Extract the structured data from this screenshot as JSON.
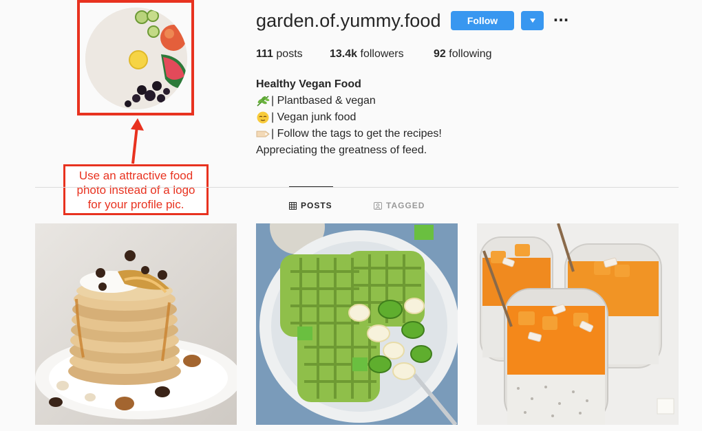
{
  "profile": {
    "username": "garden.of.yummy.food",
    "follow_label": "Follow",
    "more_label": "···"
  },
  "stats": [
    {
      "count": "111",
      "label": "posts"
    },
    {
      "count": "13.4k",
      "label": "followers"
    },
    {
      "count": "92",
      "label": "following"
    }
  ],
  "bio": {
    "name": "Healthy Vegan Food",
    "lines": [
      {
        "icon": "herb-icon",
        "text": "| Plantbased & vegan"
      },
      {
        "icon": "relieved-face-icon",
        "text": "| Vegan junk food"
      },
      {
        "icon": "label-tag-icon",
        "text": "| Follow the tags to get the recipes!"
      }
    ],
    "closing": "Appreciating the greatness of feed."
  },
  "tabs": [
    {
      "label": "POSTS",
      "icon": "grid-icon",
      "active": true
    },
    {
      "label": "TAGGED",
      "icon": "tagged-icon",
      "active": false
    }
  ],
  "annotation": {
    "lines": [
      "Use an attractive food",
      "photo instead of a logo",
      "for your profile pic."
    ],
    "color": "#e8321f"
  },
  "posts": [
    {
      "name": "pancake-stack-post"
    },
    {
      "name": "green-waffles-post"
    },
    {
      "name": "mango-chia-jars-post"
    }
  ],
  "colors": {
    "accent": "#3897f0",
    "annotation": "#e8321f"
  }
}
